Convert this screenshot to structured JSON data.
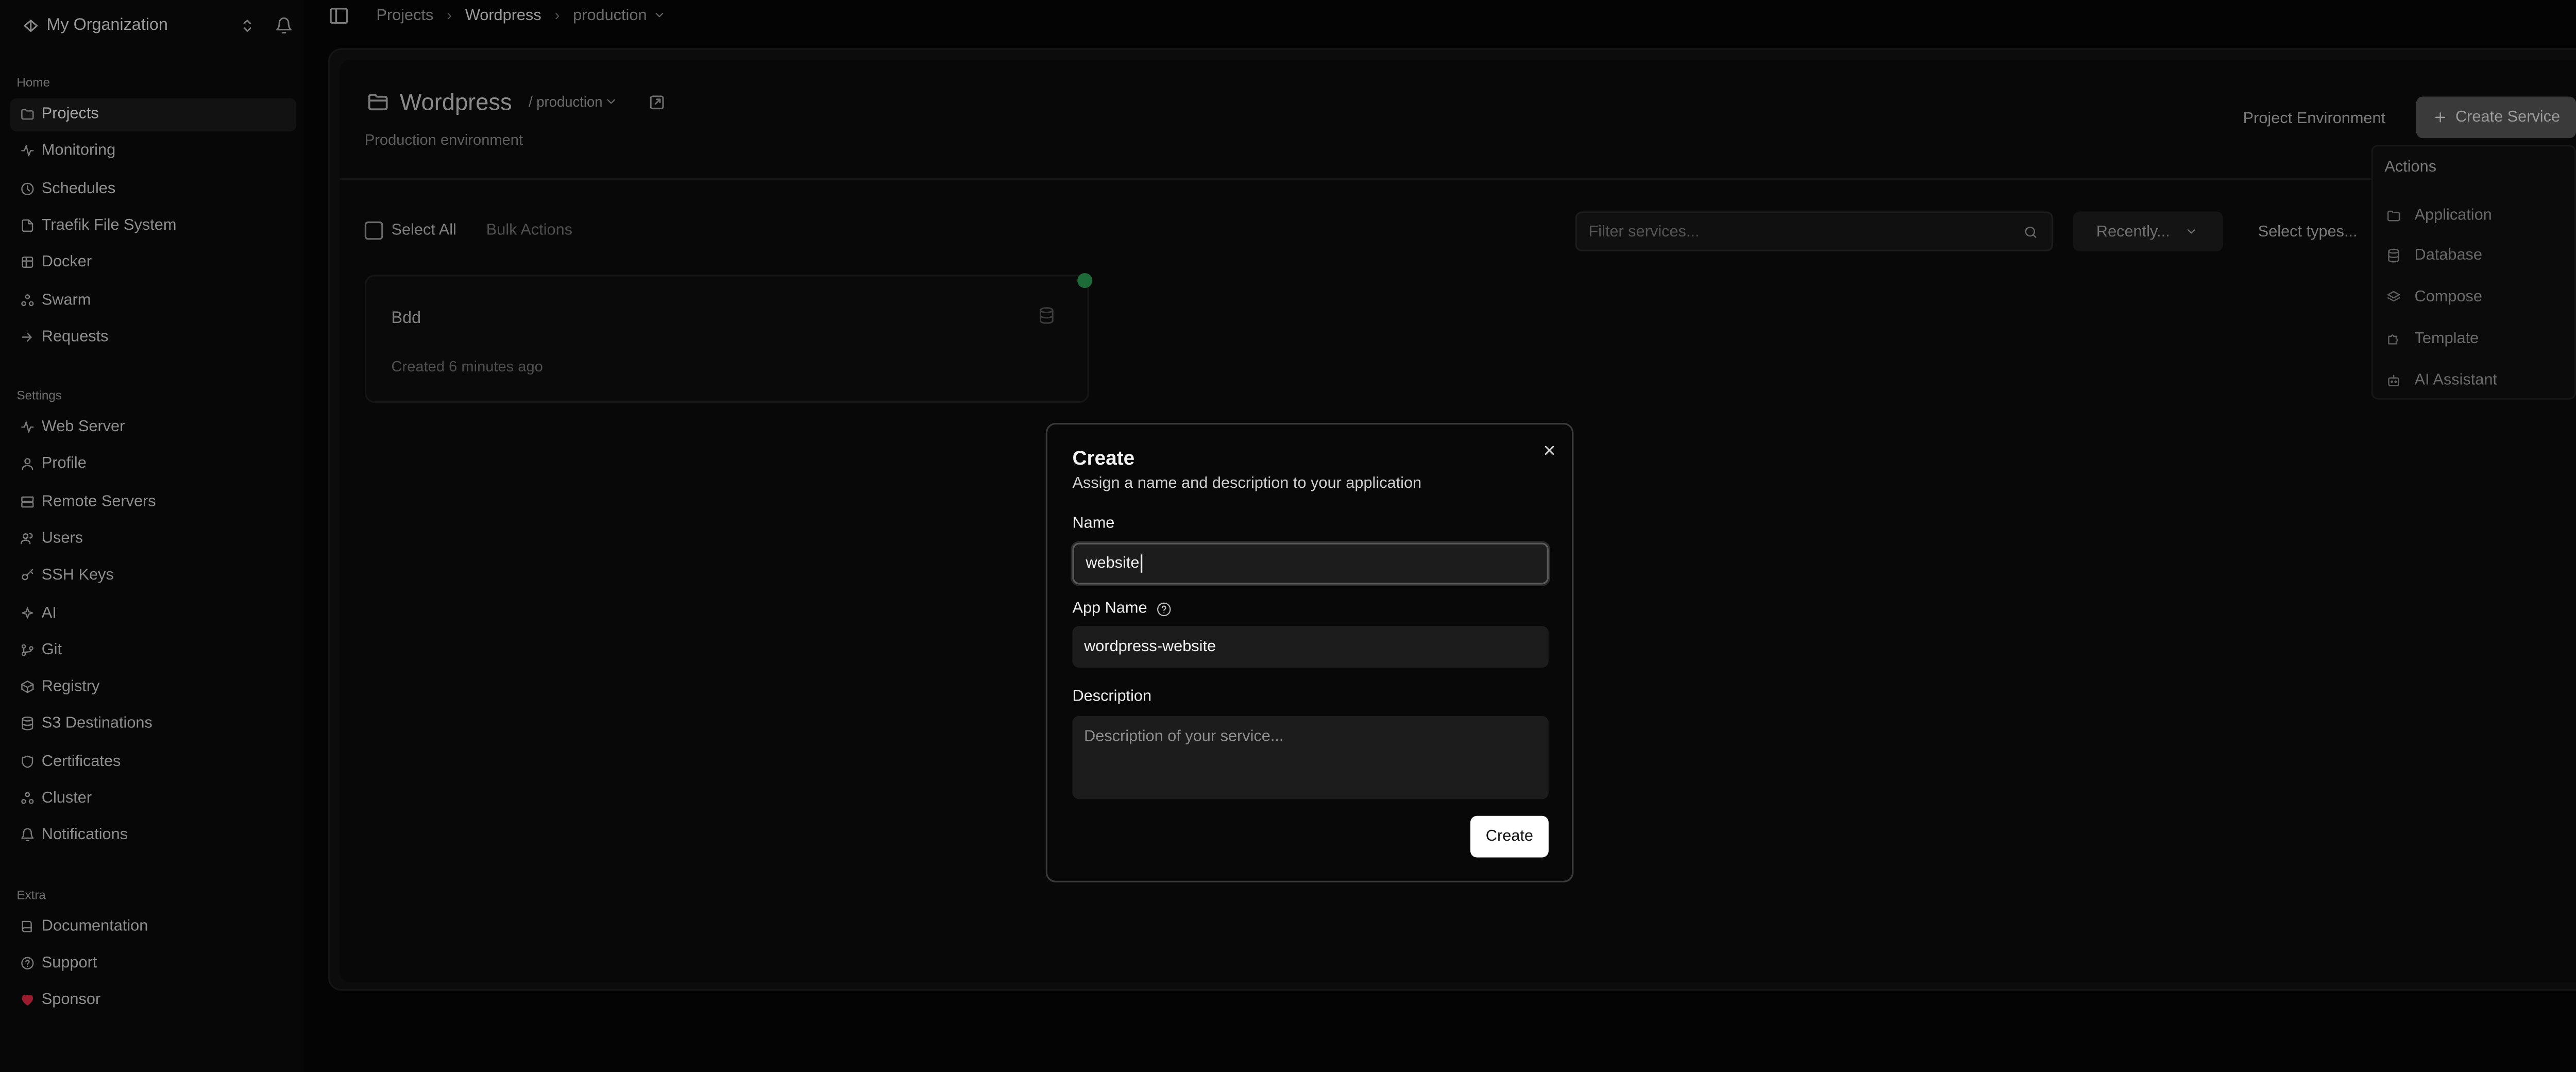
{
  "sidebar": {
    "org_name": "My Organization",
    "sections": {
      "home": "Home",
      "settings": "Settings",
      "extra": "Extra"
    },
    "home_items": [
      {
        "label": "Projects",
        "icon": "folder-icon"
      },
      {
        "label": "Monitoring",
        "icon": "activity-icon"
      },
      {
        "label": "Schedules",
        "icon": "clock-icon"
      },
      {
        "label": "Traefik File System",
        "icon": "file-icon"
      },
      {
        "label": "Docker",
        "icon": "box-icon"
      },
      {
        "label": "Swarm",
        "icon": "cluster-icon"
      },
      {
        "label": "Requests",
        "icon": "arrow-icon"
      }
    ],
    "settings_items": [
      {
        "label": "Web Server",
        "icon": "activity-icon"
      },
      {
        "label": "Profile",
        "icon": "user-icon"
      },
      {
        "label": "Remote Servers",
        "icon": "server-icon"
      },
      {
        "label": "Users",
        "icon": "users-icon"
      },
      {
        "label": "SSH Keys",
        "icon": "key-icon"
      },
      {
        "label": "AI",
        "icon": "ai-icon"
      },
      {
        "label": "Git",
        "icon": "git-icon"
      },
      {
        "label": "Registry",
        "icon": "registry-icon"
      },
      {
        "label": "S3 Destinations",
        "icon": "database-icon"
      },
      {
        "label": "Certificates",
        "icon": "shield-icon"
      },
      {
        "label": "Cluster",
        "icon": "cluster-icon"
      },
      {
        "label": "Notifications",
        "icon": "bell-icon"
      }
    ],
    "extra_items": [
      {
        "label": "Documentation",
        "icon": "book-icon"
      },
      {
        "label": "Support",
        "icon": "help-icon"
      },
      {
        "label": "Sponsor",
        "icon": "heart-icon"
      }
    ]
  },
  "breadcrumb": {
    "projects": "Projects",
    "project": "Wordpress",
    "environment": "production"
  },
  "project": {
    "title": "Wordpress",
    "env_label": "/ production",
    "description": "Production environment",
    "env_button": "Project Environment",
    "create_service": "Create Service"
  },
  "toolbar": {
    "select_all": "Select All",
    "bulk_actions": "Bulk Actions",
    "filter_placeholder": "Filter services...",
    "sort_label": "Recently...",
    "type_label": "Select types..."
  },
  "services": [
    {
      "name": "Bdd",
      "meta": "Created 6 minutes ago"
    }
  ],
  "actions_menu": {
    "header": "Actions",
    "items": [
      {
        "label": "Application",
        "icon": "folder-icon"
      },
      {
        "label": "Database",
        "icon": "database-icon"
      },
      {
        "label": "Compose",
        "icon": "layers-icon"
      },
      {
        "label": "Template",
        "icon": "puzzle-icon"
      },
      {
        "label": "AI Assistant",
        "icon": "bot-icon"
      }
    ]
  },
  "modal": {
    "title": "Create",
    "subtitle": "Assign a name and description to your application",
    "name_label": "Name",
    "name_value": "website",
    "app_name_label": "App Name",
    "app_name_value": "wordpress-website",
    "description_label": "Description",
    "description_placeholder": "Description of your service...",
    "submit_label": "Create"
  },
  "colors": {
    "background": "#040404",
    "status_running": "#1e6b3a",
    "submit_bg": "#ffffff",
    "sponsor_icon": "#9b1c2e"
  }
}
